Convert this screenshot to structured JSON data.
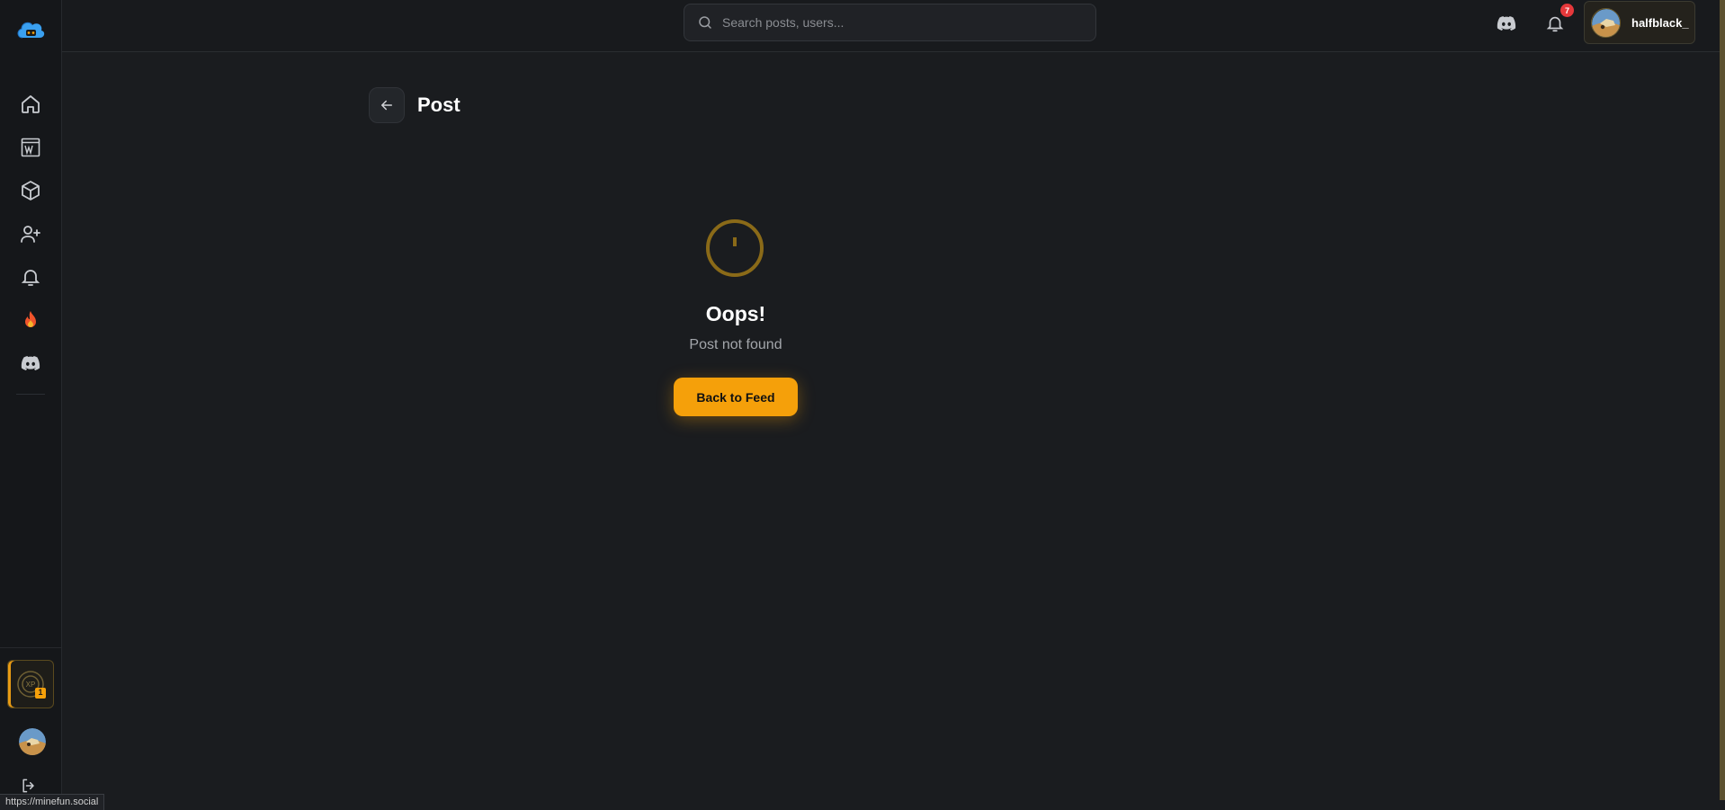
{
  "header": {
    "search_placeholder": "Search posts, users...",
    "notifications_count": "7",
    "username": "halfblack_"
  },
  "sidebar": {
    "items": [
      {
        "name": "home"
      },
      {
        "name": "wiki"
      },
      {
        "name": "mods"
      },
      {
        "name": "add-friend"
      },
      {
        "name": "notifications"
      },
      {
        "name": "trending"
      },
      {
        "name": "discord"
      }
    ],
    "xp_label": "XP",
    "xp_level": "1"
  },
  "page": {
    "title": "Post",
    "error_heading": "Oops!",
    "error_message": "Post not found",
    "back_button_label": "Back to Feed"
  },
  "status_bar": {
    "url": "https://minefun.social"
  },
  "colors": {
    "accent": "#f5a00a",
    "background": "#1a1c1f",
    "sidebar": "#15171a",
    "badge": "#e5383b"
  }
}
